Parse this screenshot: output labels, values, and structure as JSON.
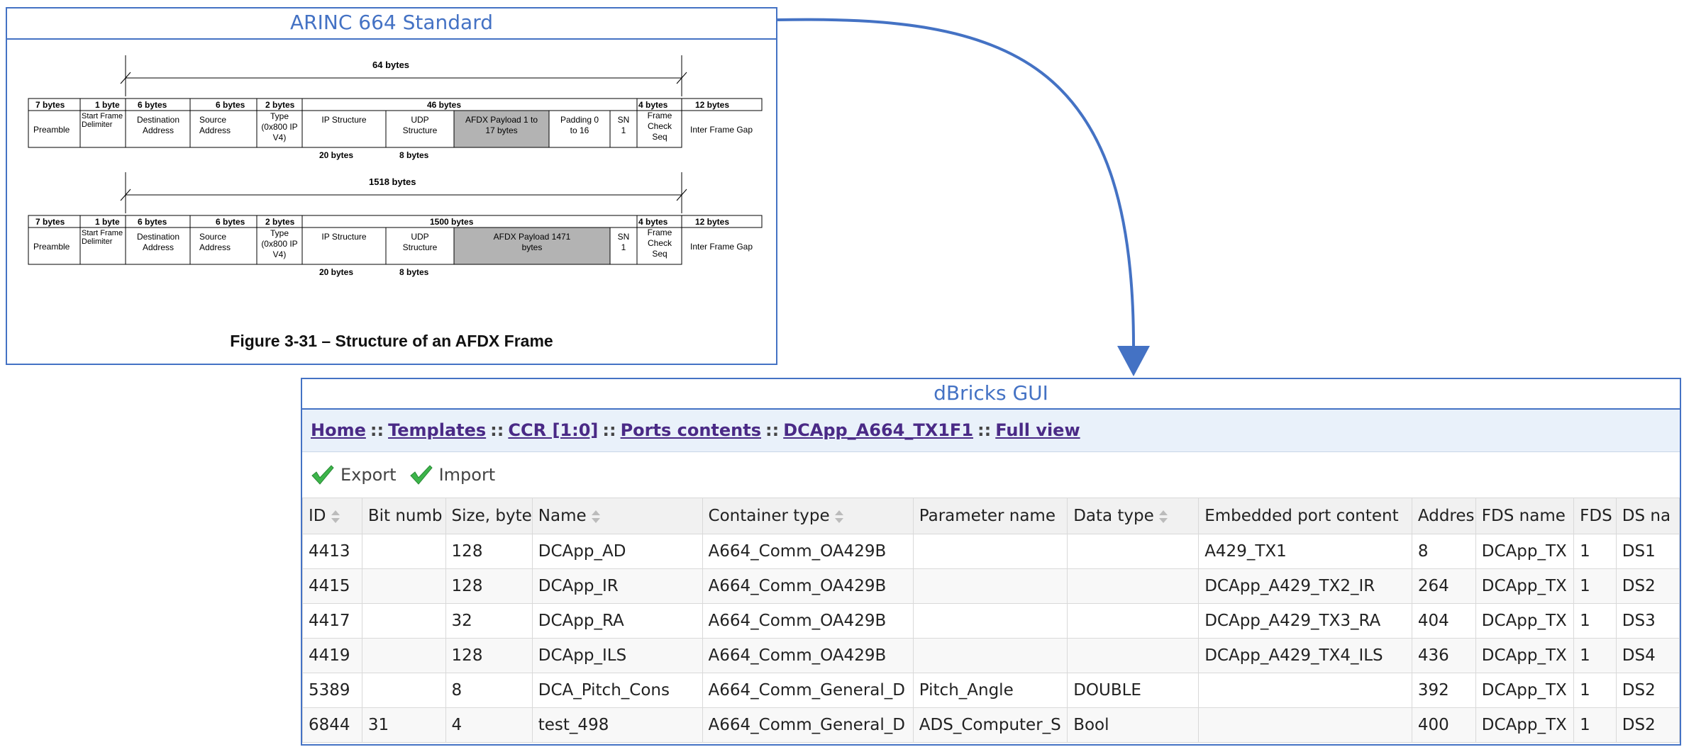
{
  "top_panel": {
    "title": "ARINC 664 Standard",
    "frame1": {
      "span_label": "64 bytes",
      "sizes": [
        "7 bytes",
        "1 byte",
        "6 bytes",
        "6 bytes",
        "2 bytes",
        "46 bytes",
        "4 bytes",
        "12 bytes"
      ],
      "fields": [
        "Preamble",
        "Start Frame Delimiter",
        "Destination Address",
        "Source Address",
        "Type (0x800 IP V4)",
        "IP Structure",
        "UDP Structure",
        "AFDX Payload 1 to 17 bytes",
        "Padding 0 to 16",
        "SN 1",
        "Frame Check Seq",
        "Inter Frame Gap"
      ],
      "sub_sizes": [
        "20 bytes",
        "8 bytes"
      ]
    },
    "frame2": {
      "span_label": "1518 bytes",
      "sizes": [
        "7 bytes",
        "1 byte",
        "6 bytes",
        "6 bytes",
        "2 bytes",
        "1500 bytes",
        "4 bytes",
        "12 bytes"
      ],
      "fields": [
        "Preamble",
        "Start Frame Delimiter",
        "Destination Address",
        "Source Address",
        "Type (0x800 IP V4)",
        "IP Structure",
        "UDP Structure",
        "AFDX Payload 1471 bytes",
        "SN 1",
        "Frame Check Seq",
        "Inter Frame Gap"
      ],
      "sub_sizes": [
        "20 bytes",
        "8 bytes"
      ]
    },
    "caption": "Figure 3-31 – Structure of an AFDX Frame"
  },
  "bottom_panel": {
    "title": "dBricks GUI",
    "breadcrumb": [
      "Home",
      "Templates",
      "CCR [1:0]",
      "Ports contents",
      "DCApp_A664_TX1F1",
      "Full view"
    ],
    "breadcrumb_sep": "::",
    "toolbar": {
      "export_label": "Export",
      "import_label": "Import"
    },
    "table": {
      "columns": [
        "ID",
        "Bit numb",
        "Size, byte",
        "Name",
        "Container type",
        "Parameter name",
        "Data type",
        "Embedded port content",
        "Addres",
        "FDS name",
        "FDS",
        "DS na"
      ],
      "rows": [
        [
          "4413",
          "",
          "128",
          "DCApp_AD",
          "A664_Comm_OA429B",
          "",
          "",
          "A429_TX1",
          "8",
          "DCApp_TX",
          "1",
          "DS1"
        ],
        [
          "4415",
          "",
          "128",
          "DCApp_IR",
          "A664_Comm_OA429B",
          "",
          "",
          "DCApp_A429_TX2_IR",
          "264",
          "DCApp_TX",
          "1",
          "DS2"
        ],
        [
          "4417",
          "",
          "32",
          "DCApp_RA",
          "A664_Comm_OA429B",
          "",
          "",
          "DCApp_A429_TX3_RA",
          "404",
          "DCApp_TX",
          "1",
          "DS3"
        ],
        [
          "4419",
          "",
          "128",
          "DCApp_ILS",
          "A664_Comm_OA429B",
          "",
          "",
          "DCApp_A429_TX4_ILS",
          "436",
          "DCApp_TX",
          "1",
          "DS4"
        ],
        [
          "5389",
          "",
          "8",
          "DCA_Pitch_Cons",
          "A664_Comm_General_D",
          "Pitch_Angle",
          "DOUBLE",
          "",
          "392",
          "DCApp_TX",
          "1",
          "DS2"
        ],
        [
          "6844",
          "31",
          "4",
          "test_498",
          "A664_Comm_General_D",
          "ADS_Computer_S",
          "Bool",
          "",
          "400",
          "DCApp_TX",
          "1",
          "DS2"
        ]
      ]
    }
  },
  "colors": {
    "accent": "#4472c4",
    "payload_fill": "#b3b3b3",
    "link": "#4a2a86",
    "check": "#3cb54a"
  }
}
